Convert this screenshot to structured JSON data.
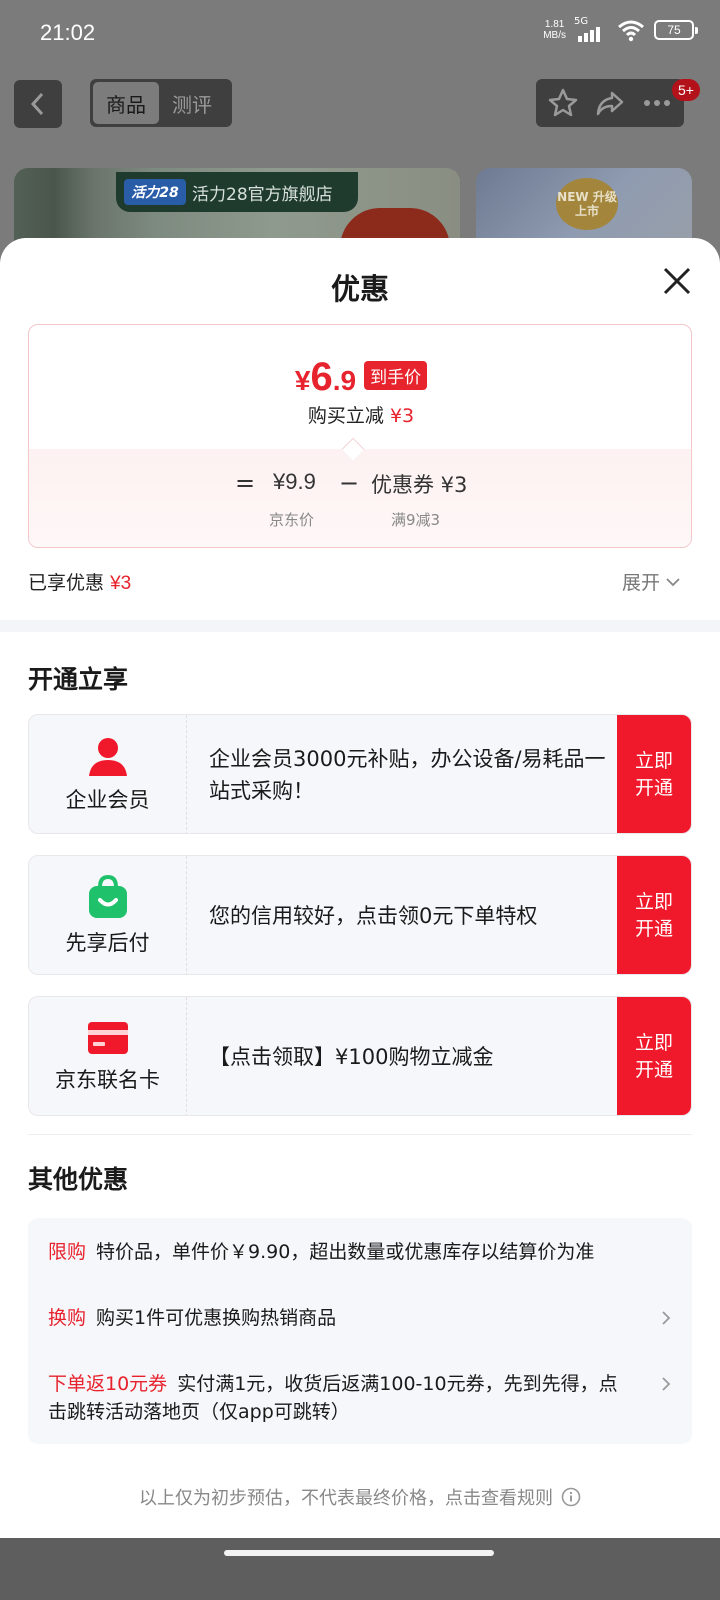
{
  "status_bar": {
    "time": "21:02",
    "net_speed_value": "1.81",
    "net_speed_unit": "MB/s",
    "network": "5G",
    "battery": "75"
  },
  "product_nav": {
    "tabs": [
      "商品",
      "测评"
    ],
    "active_tab": "商品",
    "badge": "5+",
    "shop_logo_text": "活力28",
    "shop_name": "活力28官方旗舰店",
    "new_tag": "NEW 升级上市"
  },
  "sheet": {
    "title": "优惠",
    "price_card": {
      "currency": "¥",
      "final_int": "6",
      "final_dec": ".9",
      "final_label": "到手价",
      "instant_off_label": "购买立减",
      "instant_off_value": "¥3",
      "equals": "=",
      "base_price": "¥9.9",
      "minus": "−",
      "coupon_text": "优惠券 ¥3",
      "base_price_label": "京东价",
      "coupon_rule": "满9减3"
    },
    "enjoyed_label": "已享优惠",
    "enjoyed_value": "¥3",
    "expand_label": "展开"
  },
  "open_section": {
    "title": "开通立享",
    "cards": [
      {
        "name": "企业会员",
        "desc": "企业会员3000元补贴，办公设备/易耗品一站式采购！",
        "button": "立即开通",
        "icon": "person-icon",
        "color": "#f0192b"
      },
      {
        "name": "先享后付",
        "desc": "您的信用较好，点击领0元下单特权",
        "button": "立即开通",
        "icon": "shopping-bag-icon",
        "color": "#1fc16b"
      },
      {
        "name": "京东联名卡",
        "desc": "【点击领取】¥100购物立减金",
        "button": "立即开通",
        "icon": "credit-card-icon",
        "color": "#f0192b"
      }
    ]
  },
  "other_section": {
    "title": "其他优惠",
    "rows": [
      {
        "tag": "限购",
        "text": "特价品，单件价￥9.90，超出数量或优惠库存以结算价为准",
        "has_arrow": false
      },
      {
        "tag": "换购",
        "text": "购买1件可优惠换购热销商品",
        "has_arrow": true
      },
      {
        "tag": "下单返10元券",
        "text": "实付满1元，收货后返满100-10元券，先到先得，点击跳转活动落地页（仅app可跳转）",
        "has_arrow": true
      }
    ]
  },
  "disclaimer": "以上仅为初步预估，不代表最终价格，点击查看规则"
}
